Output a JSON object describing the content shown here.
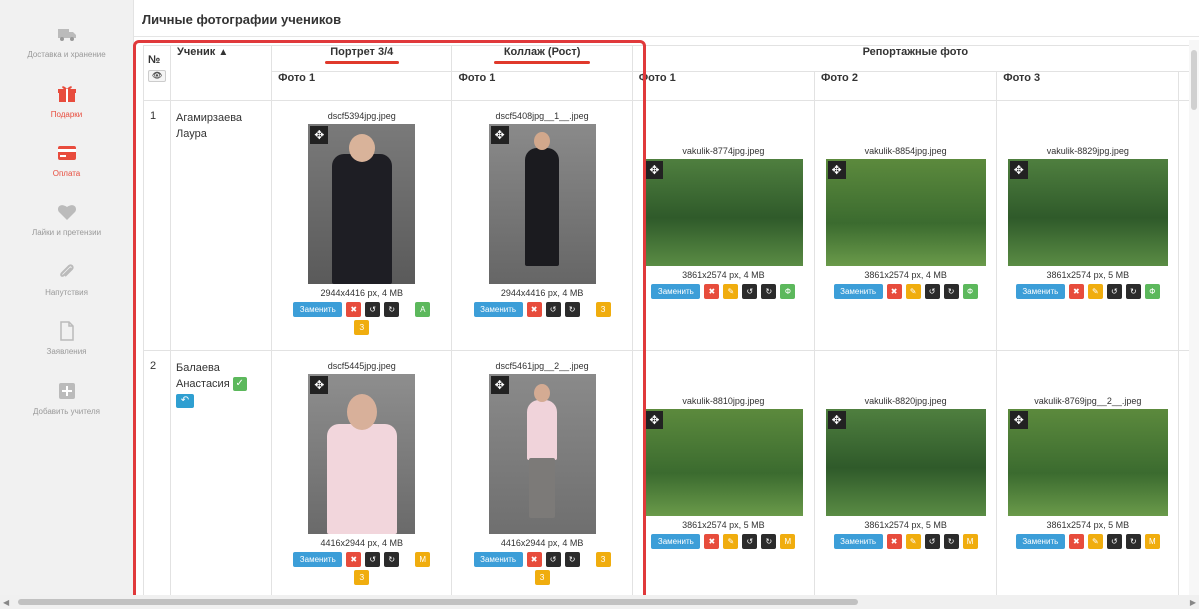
{
  "sidebar": {
    "items": [
      {
        "label": "Доставка и хранение",
        "icon": "truck-icon",
        "active": false
      },
      {
        "label": "Подарки",
        "icon": "gift-icon",
        "active": true
      },
      {
        "label": "Оплата",
        "icon": "credit-card-icon",
        "active": true
      },
      {
        "label": "Лайки и претензии",
        "icon": "heart-icon",
        "active": false
      },
      {
        "label": "Напутствия",
        "icon": "paperclip-icon",
        "active": false
      },
      {
        "label": "Заявления",
        "icon": "document-icon",
        "active": false
      },
      {
        "label": "Добавить учителя",
        "icon": "plus-square-icon",
        "active": false
      }
    ]
  },
  "panel": {
    "title": "Личные фотографии учеников"
  },
  "table": {
    "num_header": "№",
    "student_header": "Ученик",
    "groups": {
      "portrait": "Портрет 3/4",
      "collage": "Коллаж (Рост)",
      "report": "Репортажные фото"
    },
    "cols": {
      "portrait_photo1": "Фото 1",
      "collage_photo1": "Фото 1",
      "report_photo1": "Фото 1",
      "report_photo2": "Фото 2",
      "report_photo3": "Фото 3"
    },
    "buttons": {
      "replace": "Заменить",
      "delete": "✖",
      "rotate_left": "↺",
      "rotate_right": "↻",
      "edit": "✎"
    },
    "rows": [
      {
        "num": "1",
        "name": "Агамирзаева Лаура",
        "portrait": {
          "file": "dscf5394jpg.jpeg",
          "dims": "2944x4416 px, 4 MB",
          "badges": [
            "З",
            "А"
          ]
        },
        "collage": {
          "file": "dscf5408jpg__1__.jpeg",
          "dims": "2944x4416 px, 4 MB",
          "badges": [
            "З"
          ]
        },
        "report": [
          {
            "file": "vakulik-8774jpg.jpeg",
            "dims": "3861x2574 px, 4 MB",
            "badge": "Ф"
          },
          {
            "file": "vakulik-8854jpg.jpeg",
            "dims": "3861x2574 px, 4 MB",
            "badge": "Ф"
          },
          {
            "file": "vakulik-8829jpg.jpeg",
            "dims": "3861x2574 px, 5 MB",
            "badge": "Ф"
          }
        ]
      },
      {
        "num": "2",
        "name": "Балаева Анастасия",
        "portrait": {
          "file": "dscf5445jpg.jpeg",
          "dims": "4416x2944 px, 4 MB",
          "badges": [
            "З",
            "М"
          ]
        },
        "collage": {
          "file": "dscf5461jpg__2__.jpeg",
          "dims": "4416x2944 px, 4 MB",
          "badges": [
            "З",
            "З"
          ]
        },
        "report": [
          {
            "file": "vakulik-8810jpg.jpeg",
            "dims": "3861x2574 px, 5 MB",
            "badge": "М"
          },
          {
            "file": "vakulik-8820jpg.jpeg",
            "dims": "3861x2574 px, 5 MB",
            "badge": "М"
          },
          {
            "file": "vakulik-8769jpg__2__.jpeg",
            "dims": "3861x2574 px, 5 MB",
            "badge": "М"
          }
        ]
      }
    ]
  },
  "colors": {
    "accent_red": "#e0393b",
    "button_blue": "#3c9ed8",
    "button_yellow": "#f0ad0e",
    "button_green": "#5cb85c"
  }
}
